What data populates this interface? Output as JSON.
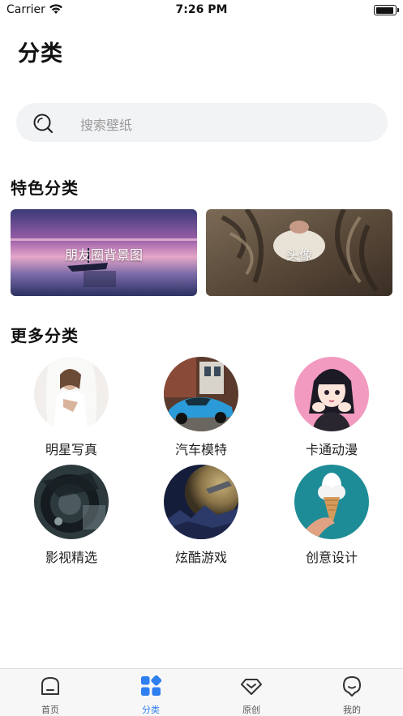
{
  "status_bar": {
    "carrier": "Carrier",
    "time": "7:26 PM"
  },
  "page": {
    "title": "分类"
  },
  "search": {
    "placeholder": "搜索壁纸",
    "icon": "search-icon"
  },
  "featured": {
    "title": "特色分类",
    "items": [
      {
        "label": "朋友圈背景图",
        "image": "sunset-lake-boat"
      },
      {
        "label": "头像",
        "image": "tabby-cat"
      }
    ]
  },
  "more": {
    "title": "更多分类",
    "items": [
      {
        "label": "明星写真",
        "image": "bride-portrait"
      },
      {
        "label": "汽车模特",
        "image": "blue-sports-car"
      },
      {
        "label": "卡通动漫",
        "image": "anime-girl"
      },
      {
        "label": "影视精选",
        "image": "dark-machine"
      },
      {
        "label": "炫酷游戏",
        "image": "planet-landscape"
      },
      {
        "label": "创意设计",
        "image": "ice-cream-cloud"
      }
    ]
  },
  "tab_bar": {
    "active_color": "#2f7ff0",
    "tabs": [
      {
        "label": "首页",
        "icon": "home-icon",
        "active": false
      },
      {
        "label": "分类",
        "icon": "category-icon",
        "active": true
      },
      {
        "label": "原创",
        "icon": "diamond-icon",
        "active": false
      },
      {
        "label": "我的",
        "icon": "profile-icon",
        "active": false
      }
    ]
  }
}
